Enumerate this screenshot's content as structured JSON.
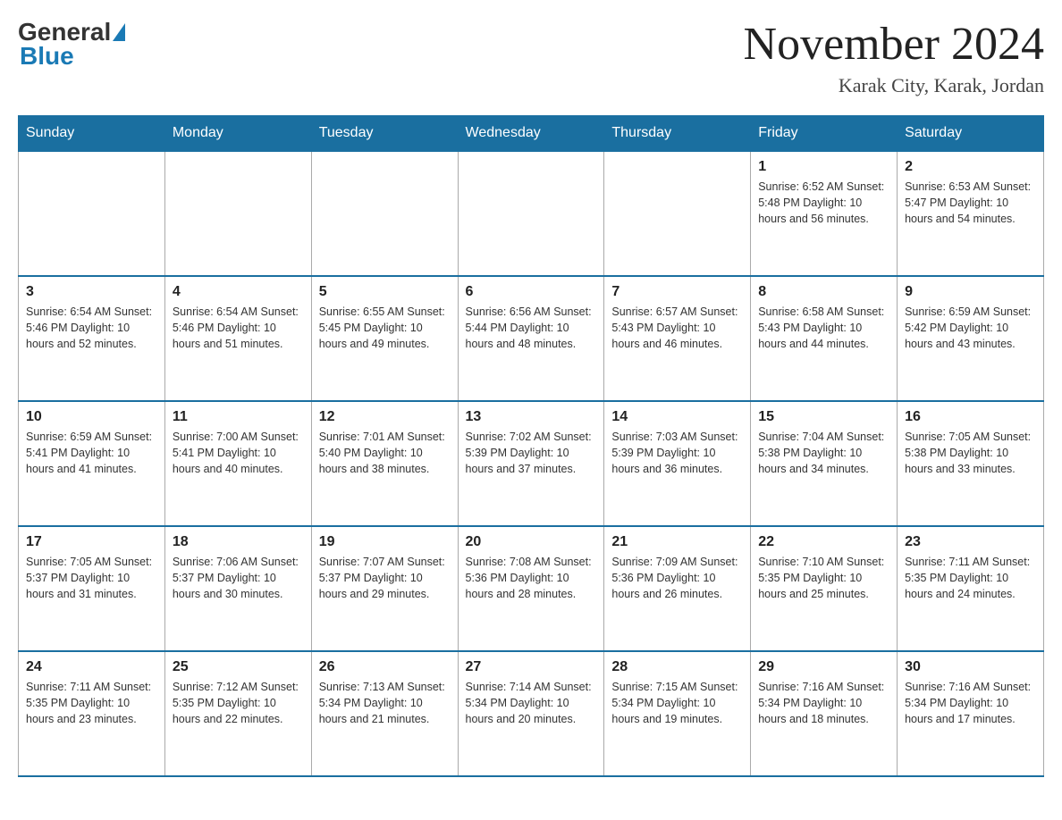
{
  "logo": {
    "general": "General",
    "blue": "Blue"
  },
  "header": {
    "month_title": "November 2024",
    "location": "Karak City, Karak, Jordan"
  },
  "days_of_week": [
    "Sunday",
    "Monday",
    "Tuesday",
    "Wednesday",
    "Thursday",
    "Friday",
    "Saturday"
  ],
  "weeks": [
    [
      {
        "day": "",
        "info": ""
      },
      {
        "day": "",
        "info": ""
      },
      {
        "day": "",
        "info": ""
      },
      {
        "day": "",
        "info": ""
      },
      {
        "day": "",
        "info": ""
      },
      {
        "day": "1",
        "info": "Sunrise: 6:52 AM\nSunset: 5:48 PM\nDaylight: 10 hours and 56 minutes."
      },
      {
        "day": "2",
        "info": "Sunrise: 6:53 AM\nSunset: 5:47 PM\nDaylight: 10 hours and 54 minutes."
      }
    ],
    [
      {
        "day": "3",
        "info": "Sunrise: 6:54 AM\nSunset: 5:46 PM\nDaylight: 10 hours and 52 minutes."
      },
      {
        "day": "4",
        "info": "Sunrise: 6:54 AM\nSunset: 5:46 PM\nDaylight: 10 hours and 51 minutes."
      },
      {
        "day": "5",
        "info": "Sunrise: 6:55 AM\nSunset: 5:45 PM\nDaylight: 10 hours and 49 minutes."
      },
      {
        "day": "6",
        "info": "Sunrise: 6:56 AM\nSunset: 5:44 PM\nDaylight: 10 hours and 48 minutes."
      },
      {
        "day": "7",
        "info": "Sunrise: 6:57 AM\nSunset: 5:43 PM\nDaylight: 10 hours and 46 minutes."
      },
      {
        "day": "8",
        "info": "Sunrise: 6:58 AM\nSunset: 5:43 PM\nDaylight: 10 hours and 44 minutes."
      },
      {
        "day": "9",
        "info": "Sunrise: 6:59 AM\nSunset: 5:42 PM\nDaylight: 10 hours and 43 minutes."
      }
    ],
    [
      {
        "day": "10",
        "info": "Sunrise: 6:59 AM\nSunset: 5:41 PM\nDaylight: 10 hours and 41 minutes."
      },
      {
        "day": "11",
        "info": "Sunrise: 7:00 AM\nSunset: 5:41 PM\nDaylight: 10 hours and 40 minutes."
      },
      {
        "day": "12",
        "info": "Sunrise: 7:01 AM\nSunset: 5:40 PM\nDaylight: 10 hours and 38 minutes."
      },
      {
        "day": "13",
        "info": "Sunrise: 7:02 AM\nSunset: 5:39 PM\nDaylight: 10 hours and 37 minutes."
      },
      {
        "day": "14",
        "info": "Sunrise: 7:03 AM\nSunset: 5:39 PM\nDaylight: 10 hours and 36 minutes."
      },
      {
        "day": "15",
        "info": "Sunrise: 7:04 AM\nSunset: 5:38 PM\nDaylight: 10 hours and 34 minutes."
      },
      {
        "day": "16",
        "info": "Sunrise: 7:05 AM\nSunset: 5:38 PM\nDaylight: 10 hours and 33 minutes."
      }
    ],
    [
      {
        "day": "17",
        "info": "Sunrise: 7:05 AM\nSunset: 5:37 PM\nDaylight: 10 hours and 31 minutes."
      },
      {
        "day": "18",
        "info": "Sunrise: 7:06 AM\nSunset: 5:37 PM\nDaylight: 10 hours and 30 minutes."
      },
      {
        "day": "19",
        "info": "Sunrise: 7:07 AM\nSunset: 5:37 PM\nDaylight: 10 hours and 29 minutes."
      },
      {
        "day": "20",
        "info": "Sunrise: 7:08 AM\nSunset: 5:36 PM\nDaylight: 10 hours and 28 minutes."
      },
      {
        "day": "21",
        "info": "Sunrise: 7:09 AM\nSunset: 5:36 PM\nDaylight: 10 hours and 26 minutes."
      },
      {
        "day": "22",
        "info": "Sunrise: 7:10 AM\nSunset: 5:35 PM\nDaylight: 10 hours and 25 minutes."
      },
      {
        "day": "23",
        "info": "Sunrise: 7:11 AM\nSunset: 5:35 PM\nDaylight: 10 hours and 24 minutes."
      }
    ],
    [
      {
        "day": "24",
        "info": "Sunrise: 7:11 AM\nSunset: 5:35 PM\nDaylight: 10 hours and 23 minutes."
      },
      {
        "day": "25",
        "info": "Sunrise: 7:12 AM\nSunset: 5:35 PM\nDaylight: 10 hours and 22 minutes."
      },
      {
        "day": "26",
        "info": "Sunrise: 7:13 AM\nSunset: 5:34 PM\nDaylight: 10 hours and 21 minutes."
      },
      {
        "day": "27",
        "info": "Sunrise: 7:14 AM\nSunset: 5:34 PM\nDaylight: 10 hours and 20 minutes."
      },
      {
        "day": "28",
        "info": "Sunrise: 7:15 AM\nSunset: 5:34 PM\nDaylight: 10 hours and 19 minutes."
      },
      {
        "day": "29",
        "info": "Sunrise: 7:16 AM\nSunset: 5:34 PM\nDaylight: 10 hours and 18 minutes."
      },
      {
        "day": "30",
        "info": "Sunrise: 7:16 AM\nSunset: 5:34 PM\nDaylight: 10 hours and 17 minutes."
      }
    ]
  ]
}
